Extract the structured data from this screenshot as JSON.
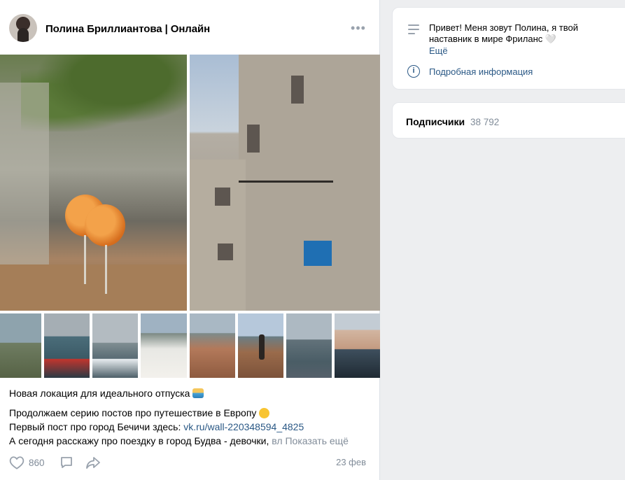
{
  "post": {
    "author": "Полина Бриллиантова | Онлайн",
    "more_label": "•••",
    "lines": {
      "title": "Новая локация для идеального отпуска",
      "intro": "Продолжаем серию постов про путешествие в Европу",
      "first_post_prefix": "Первый пост про город Бечичи здесь: ",
      "first_post_link": "vk.ru/wall-220348594_4825",
      "today_prefix": "А сегодня расскажу про поездку в город Будва - девочки,",
      "today_faded": " вл",
      "show_more": "Показать ещё"
    },
    "likes": "860",
    "date": "23 фев"
  },
  "about": {
    "text": "Привет! Меня зовут Полина, я твой\nнаставник в мире Фриланс 🤍",
    "more": "Ещё",
    "details_link": "Подробная информация"
  },
  "subscribers": {
    "label": "Подписчики",
    "count": "38 792"
  },
  "icons": {
    "more": "more-horizontal-icon",
    "like": "heart-icon",
    "comment": "comment-icon",
    "share": "share-icon",
    "about": "text-lines-icon",
    "info": "info-icon"
  },
  "colors": {
    "link": "#2a5885",
    "secondary": "#818c99",
    "background": "#edeef0"
  }
}
